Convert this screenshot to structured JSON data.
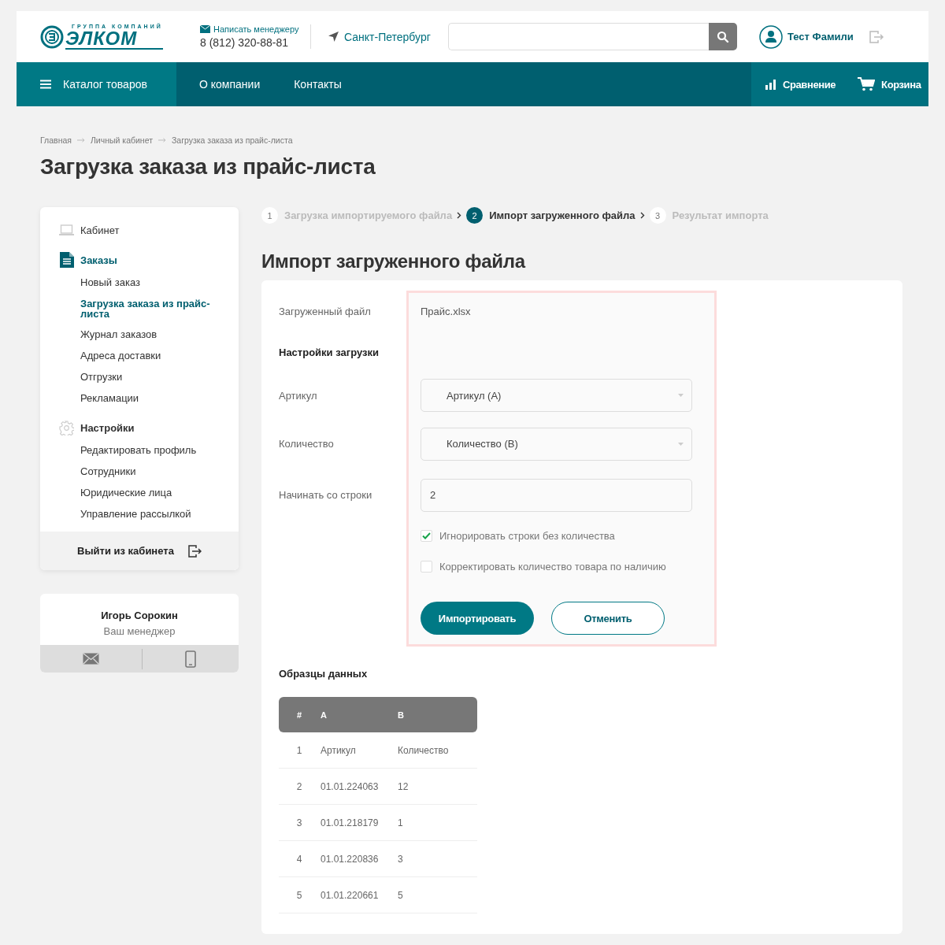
{
  "header": {
    "logo": {
      "tagline": "ГРУППА КОМПАНИЙ",
      "name": "ЭЛКОМ"
    },
    "contact": {
      "link": "Написать менеджеру",
      "phone": "8 (812) 320-88-81"
    },
    "city": "Санкт-Петербург",
    "user": "Тест Фамили"
  },
  "nav": {
    "catalog": "Каталог товаров",
    "links": [
      "О компании",
      "Контакты"
    ],
    "actions": [
      {
        "kind": "compare",
        "label": "Сравнение"
      },
      {
        "kind": "cart",
        "label": "Корзина"
      }
    ]
  },
  "breadcrumbs": [
    "Главная",
    "Личный кабинет",
    "Загрузка заказа из прайс-листа"
  ],
  "page_title": "Загрузка заказа из прайс-листа",
  "sidebar": {
    "sections": [
      {
        "kind": "cabinet",
        "title": "Кабинет",
        "selected": false
      },
      {
        "kind": "orders",
        "title": "Заказы",
        "selected": true,
        "items": [
          {
            "label": "Новый заказ",
            "selected": false
          },
          {
            "label": "Загрузка заказа из прайс-листа",
            "selected": true
          },
          {
            "label": "Журнал заказов",
            "selected": false
          },
          {
            "label": "Адреса доставки",
            "selected": false
          },
          {
            "label": "Отгрузки",
            "selected": false
          },
          {
            "label": "Рекламации",
            "selected": false
          }
        ]
      },
      {
        "kind": "settings",
        "title": "Настройки",
        "selected": false,
        "items": [
          {
            "label": "Редактировать профиль",
            "selected": false
          },
          {
            "label": "Сотрудники",
            "selected": false
          },
          {
            "label": "Юридические лица",
            "selected": false
          },
          {
            "label": "Управление рассылкой",
            "selected": false
          }
        ]
      }
    ],
    "logout": "Выйти из кабинета"
  },
  "manager": {
    "name": "Игорь Сорокин",
    "role": "Ваш менеджер"
  },
  "steps": [
    {
      "number": "1",
      "label": "Загрузка импортируемого файла",
      "selected": false
    },
    {
      "number": "2",
      "label": "Импорт загруженного файла",
      "selected": true
    },
    {
      "number": "3",
      "label": "Результат импорта",
      "selected": false
    }
  ],
  "section_title": "Импорт загруженного файла",
  "form": {
    "file_label": "Загруженный файл",
    "file_name": "Прайс.xlsx",
    "settings_title": "Настройки загрузки",
    "fields": [
      {
        "kind": "select",
        "label": "Артикул",
        "value": "Артикул (A)"
      },
      {
        "kind": "select",
        "label": "Количество",
        "value": "Количество (B)"
      },
      {
        "kind": "input",
        "label": "Начинать со строки",
        "value": "2"
      }
    ],
    "options": [
      {
        "label": "Игнорировать строки без количества",
        "checked": true
      },
      {
        "label": "Корректировать количество товара по наличию",
        "checked": false
      }
    ],
    "buttons": [
      {
        "kind": "primary",
        "label": "Импортировать"
      },
      {
        "kind": "secondary",
        "label": "Отменить"
      }
    ]
  },
  "samples": {
    "title": "Образцы данных",
    "columns": [
      "#",
      "A",
      "B"
    ],
    "rows": [
      [
        "1",
        "Артикул",
        "Количество"
      ],
      [
        "2",
        "01.01.224063",
        "12"
      ],
      [
        "3",
        "01.01.218179",
        "1"
      ],
      [
        "4",
        "01.01.220836",
        "3"
      ],
      [
        "5",
        "01.01.220661",
        "5"
      ]
    ]
  }
}
